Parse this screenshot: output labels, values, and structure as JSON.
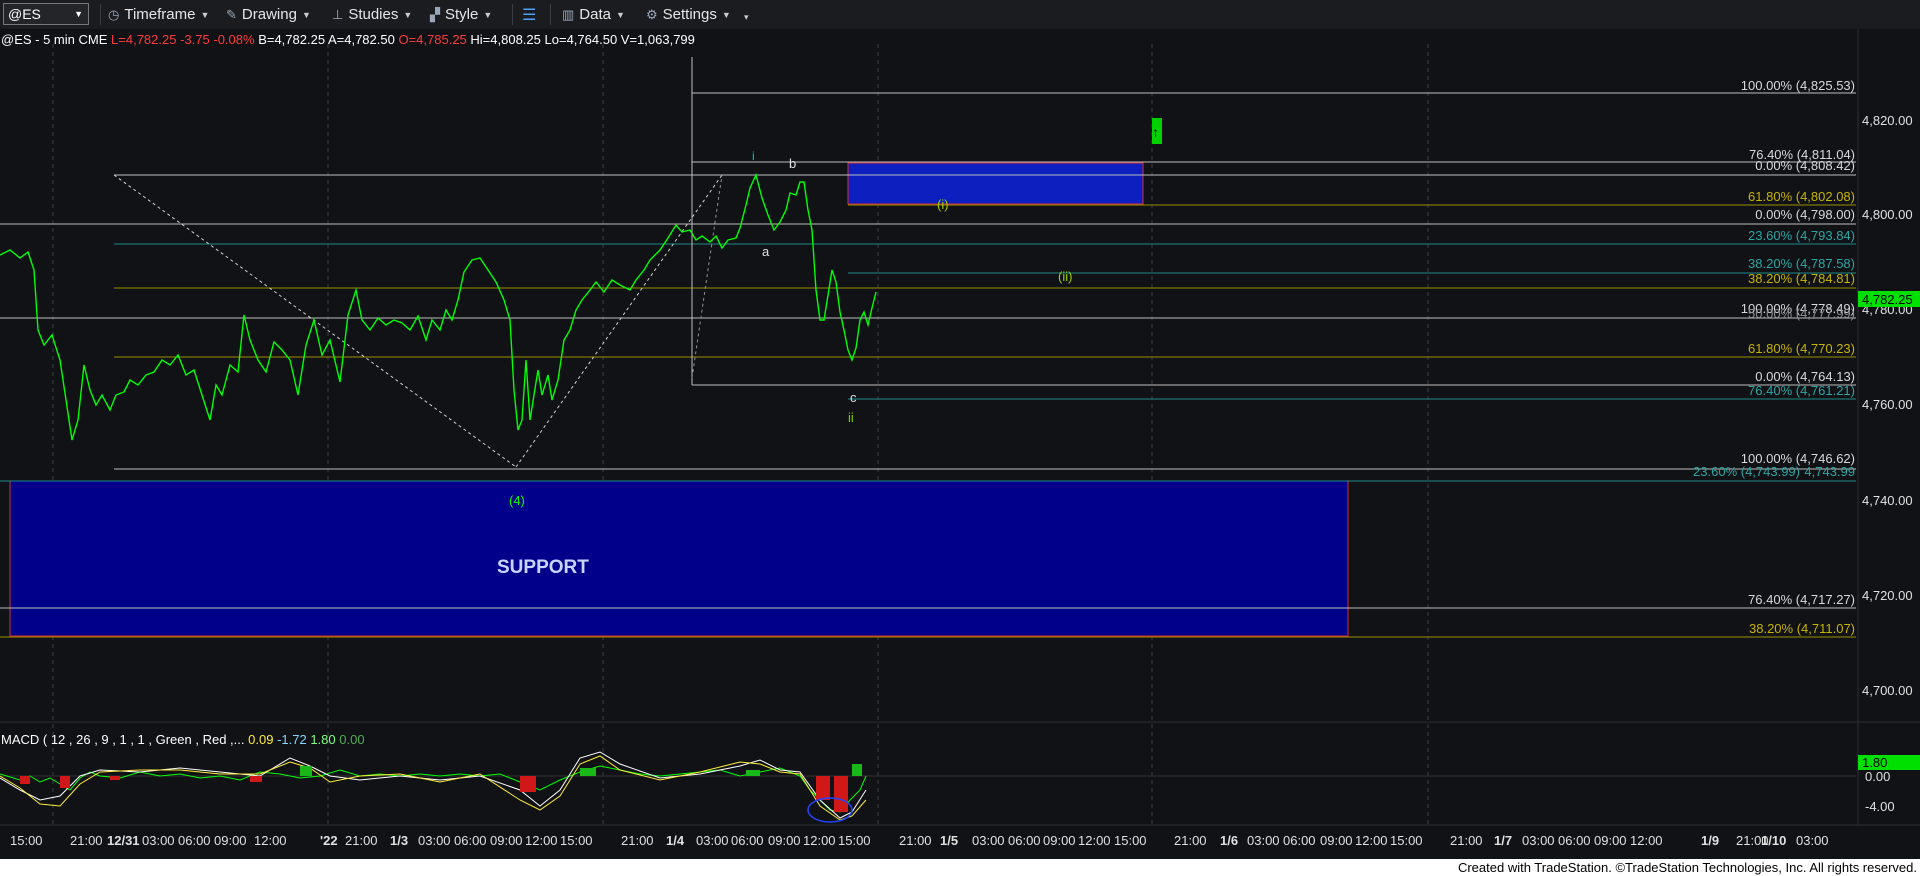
{
  "toolbar": {
    "symbol": "@ES",
    "timeframe": "Timeframe",
    "drawing": "Drawing",
    "studies": "Studies",
    "style": "Style",
    "data": "Data",
    "settings": "Settings"
  },
  "header": {
    "symbol": "@ES - 5 min",
    "exchange": "CME",
    "last": "L=4,782.25",
    "change": "-3.75",
    "pct": "-0.08%",
    "bid": "B=4,782.25",
    "ask": "A=4,782.50",
    "open": "O=4,785.25",
    "high": "Hi=4,808.25",
    "low": "Lo=4,764.50",
    "volume": "V=1,063,799"
  },
  "price_axis": {
    "ticks": [
      "4,820.00",
      "4,800.00",
      "4,780.00",
      "4,760.00",
      "4,740.00",
      "4,720.00",
      "4,700.00"
    ],
    "last_price": "4,782.25"
  },
  "time_axis": [
    "15:00",
    "21:00",
    "12/31",
    "03:00",
    "06:00",
    "09:00",
    "12:00",
    "'22",
    "21:00",
    "1/3",
    "03:00",
    "06:00",
    "09:00",
    "12:00",
    "15:00",
    "21:00",
    "1/4",
    "03:00",
    "06:00",
    "09:00",
    "12:00",
    "15:00",
    "21:00",
    "1/5",
    "03:00",
    "06:00",
    "09:00",
    "12:00",
    "15:00",
    "21:00",
    "1/6",
    "03:00",
    "06:00",
    "09:00",
    "12:00",
    "15:00",
    "21:00",
    "1/7",
    "03:00",
    "06:00",
    "09:00",
    "12:00",
    "1/9",
    "21:00",
    "1/10",
    "03:00"
  ],
  "fib_labels": [
    {
      "text": "100.00% (4,825.53)",
      "color": "#d9d9d9"
    },
    {
      "text": "76.40% (4,811.04)",
      "color": "#d9d9d9"
    },
    {
      "text": "0.00% (4,808.42)",
      "color": "#d9d9d9"
    },
    {
      "text": "61.80% (4,802.08)",
      "color": "#c8b400"
    },
    {
      "text": "0.00% (4,798.00)",
      "color": "#d9d9d9"
    },
    {
      "text": "23.60% (4,793.84)",
      "color": "#2ca6a4"
    },
    {
      "text": "38.20% (4,787.58)",
      "color": "#2ca6a4"
    },
    {
      "text": "38.20% (4,784.81)",
      "color": "#c8b400"
    },
    {
      "text": "100.00% (4,778.49)",
      "color": "#d9d9d9"
    },
    {
      "text": "50.00% (4,777.99)",
      "color": "#8c8c8c"
    },
    {
      "text": "61.80% (4,770.23)",
      "color": "#c8b400"
    },
    {
      "text": "0.00% (4,764.13)",
      "color": "#d9d9d9"
    },
    {
      "text": "76.40% (4,761.21)",
      "color": "#2ca6a4"
    },
    {
      "text": "100.00% (4,746.62)",
      "color": "#d9d9d9"
    },
    {
      "text": "23.60% (4,743.99)",
      "color": "#2ca6a4"
    },
    {
      "text": "4,743.99",
      "color": "#2ca6a4"
    },
    {
      "text": "76.40% (4,717.27)",
      "color": "#d9d9d9"
    },
    {
      "text": "38.20% (4,711.07)",
      "color": "#c8b400"
    }
  ],
  "wave_labels": {
    "i": "i",
    "b": "b",
    "a": "a",
    "c": "c",
    "ii": "ii",
    "wave_i_target": "(i)",
    "wave_ii_target": "(ii)",
    "wave_4": "(4)"
  },
  "support_label": "SUPPORT",
  "macd": {
    "title": "MACD ( 12 , 26 , 9 , 1 , 1 , Green , Red ,...",
    "v1": "0.09",
    "v2": "-1.72",
    "v3": "1.80",
    "v4": "0.00",
    "axis_ticks": [
      "0.00",
      "-4.00"
    ],
    "last": "1.80"
  },
  "footer": "Created with TradeStation. ©TradeStation Technologies, Inc. All rights reserved.",
  "colors": {
    "price_line": "#00ff00",
    "support_fill": "#00008b",
    "support_border": "#d32f2f",
    "target_box": "#0d1fbf",
    "last_price_tag": "#00e000",
    "fib_yellow": "#c8b400",
    "fib_teal": "#2ca6a4",
    "fib_white": "#d9d9d9"
  }
}
